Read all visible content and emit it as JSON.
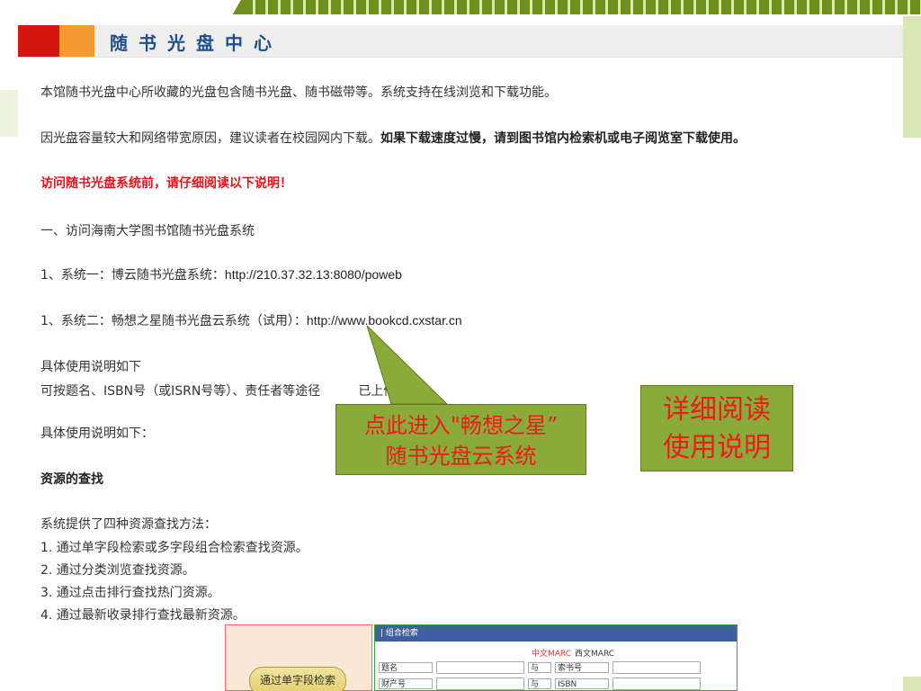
{
  "header": {
    "title": "随书光盘中心"
  },
  "content": {
    "intro": "本馆随书光盘中心所收藏的光盘包含随书光盘、随书磁带等。系统支持在线浏览和下载功能。",
    "bandwidth_normal": "因光盘容量较大和网络带宽原因，建议读者在校园网内下载。",
    "bandwidth_bold": "如果下载速度过慢，请到图书馆内检索机或电子阅览室下载使用。",
    "notice": "访问随书光盘系统前，请仔细阅读以下说明！",
    "section1": "一、访问海南大学图书馆随书光盘系统",
    "system1_label": "1、系统一：博云随书光盘系统：",
    "system1_url": "http://210.37.32.13:8080/poweb",
    "system2_label": "1、系统二：畅想之星随书光盘云系统（试用）：",
    "system2_url": "http://www.bookcd.cxstar.cn",
    "usage_line1": "具体使用说明如下",
    "usage_line2_a": "可按题名、ISBN号（或ISRN号等）、责任者等途径",
    "usage_line2_b": "已上传光盘。",
    "usage_line3": "具体使用说明如下：",
    "resources_heading": "资源的查找",
    "methods_intro": "系统提供了四种资源查找方法：",
    "methods": [
      "1. 通过单字段检索或多字段组合检索查找资源。",
      "2. 通过分类浏览查找资源。",
      "3. 通过点击排行查找热门资源。",
      "4. 通过最新收录排行查找最新资源。"
    ]
  },
  "callouts": {
    "enter_line1": "点此进入\"畅想之星”",
    "enter_line2": "随书光盘云系统",
    "read_line1": "详细阅读",
    "read_line2": "使用说明"
  },
  "screenshot": {
    "button": "通过单字段检索",
    "header": "| 组合检索",
    "tab_cn": "中文MARC",
    "tab_west": "西文MARC",
    "rows": [
      {
        "field": "题名",
        "op": "与",
        "field2": "索书号"
      },
      {
        "field": "财产号",
        "op": "与",
        "field2": "ISBN"
      }
    ]
  },
  "colors": {
    "accent_red": "#d5150f",
    "accent_orange": "#f59a2e",
    "title_blue": "#1f4f8e",
    "callout_green": "#8aab3a",
    "callout_text": "#ee1b1b"
  }
}
